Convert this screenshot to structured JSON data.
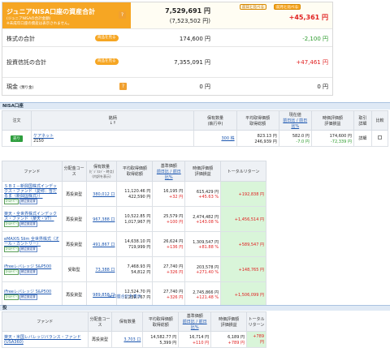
{
  "summary": {
    "title": "ジュニアNISA口座の資産合計",
    "title_note": "※未成年口座の資産は表示されません。",
    "title_note2": "(ジュニアNISAの合計金額)",
    "total": "7,529,691 円",
    "total_prev": "(7,523,502 円)",
    "total_change": "+45,361 円",
    "compare_buttons": [
      "前日と比べる",
      "前月と比べる"
    ],
    "stock_label": "株式の合計",
    "stock_badge": "商品を見る",
    "stock_value": "174,600 円",
    "stock_change": "-2,100 円",
    "fund_label": "投資信託の合計",
    "fund_badge": "商品を見る",
    "fund_value": "7,355,091 円",
    "fund_change": "+47,461 円",
    "cash_label": "現金",
    "cash_note": "(預り金)",
    "cash_value": "0 円",
    "cash_change": "0 円",
    "help": "?"
  },
  "nisa_section": {
    "title": "NISA口座",
    "headers": [
      "注文",
      "銘柄",
      "↓↑",
      "保有数量",
      "(執行中)",
      "平均取得価額",
      "取得総額",
      "現在値",
      "前日比 / 前日比%",
      "時価評価額",
      "評価損益",
      "取引",
      "詳細",
      "比較"
    ],
    "row": {
      "order": "売り",
      "name": "ケアネット",
      "code": "2150",
      "qty": "300 株",
      "avg": "823.13 円",
      "total": "246,939 円",
      "price": "582.0 円",
      "diff": "-7.0 円",
      "value": "174,600 円",
      "pl": "-72,339 円",
      "detail": "詳細"
    }
  },
  "fund_section": {
    "headers": [
      "ファンド",
      "分配金コース",
      "保有数量",
      "(ﾋﾞｼﾞﾈｽﾃﾞｰ 時点)",
      "(内訳を表示)",
      "平均取得価額",
      "取得総額",
      "基準価額",
      "前日比 / 前日比%",
      "時価評価額",
      "評価損益",
      "トータルリターン"
    ],
    "rows": [
      {
        "name": "ＳＢＩ－新興国株式インデックス・ファンド（愛称：雪だるま（新興国株式））",
        "course": "再投資型",
        "qty": "380,012 口",
        "avg": "11,120.46 円",
        "total": "422,590 円",
        "nav": "16,195 円",
        "nav_diff": "+32 円",
        "value": "615,429 円",
        "pl": "+45.63 %",
        "ret": "+192,838 円"
      },
      {
        "name": "楽天・全世界株式インデックス・ファンド（楽天・VT）",
        "course": "再投資型",
        "qty": "967,388 口",
        "avg": "10,522.85 円",
        "total": "1,017,967 円",
        "nav": "25,579 円",
        "nav_diff": "+100 円",
        "value": "2,474,482 円",
        "pl": "+143.08 %",
        "ret": "+1,456,514 円"
      },
      {
        "name": "eMAXIS Slim 全世界株式（オール・カントリー）",
        "course": "再投資型",
        "qty": "491,867 口",
        "avg": "14,638.10 円",
        "total": "719,999 円",
        "nav": "26,624 円",
        "nav_diff": "+136 円",
        "value": "1,309,547 円",
        "pl": "+81.88 %",
        "ret": "+589,547 円"
      },
      {
        "name": "iFreeレバレッジ S&P500",
        "course": "受取型",
        "qty": "73,388 口",
        "avg": "7,468.93 円",
        "total": "54,812 円",
        "nav": "27,740 円",
        "nav_diff": "+326 円",
        "value": "203,578 円",
        "pl": "+271.40 %",
        "ret": "+148,765 円"
      },
      {
        "name": "iFreeレバレッジ S&P500",
        "course": "再投資型",
        "qty": "989,858 口",
        "avg": "12,524.70 円",
        "total": "1,239,767 円",
        "nav": "27,740 円",
        "nav_diff": "+326 円",
        "value": "2,745,866 円",
        "pl": "+121.48 %",
        "ret": "+1,506,099 円"
      }
    ],
    "tags": [
      "ﾛｰﾙｵｰﾊﾞｰ",
      "積立設定済"
    ],
    "show_more": "口座合計を表示"
  },
  "third_section": {
    "title": "投",
    "headers": [
      "ファンド",
      "分配金コース",
      "保有数量",
      "平均取得価額",
      "取得総額",
      "基準価額",
      "前日比 / 前日比%",
      "時価評価額",
      "評価損益",
      "トータルリターン"
    ],
    "row": {
      "name": "楽天・米国レバレッジバランス・ファンド(USA360)",
      "course": "再投資型",
      "qty": "3,703 口",
      "avg": "14,582.77 円",
      "total": "5,399 円",
      "nav": "16,714 円",
      "nav_diff": "+110 円",
      "value": "6,189 円",
      "pl": "+789 円",
      "ret": "+789 円"
    }
  },
  "colors": {
    "accent": "#f6a623",
    "positive": "#e02020",
    "negative": "#2a9a2a",
    "buy": "#2e9e3e",
    "header_bg": "#dfe9f5"
  }
}
